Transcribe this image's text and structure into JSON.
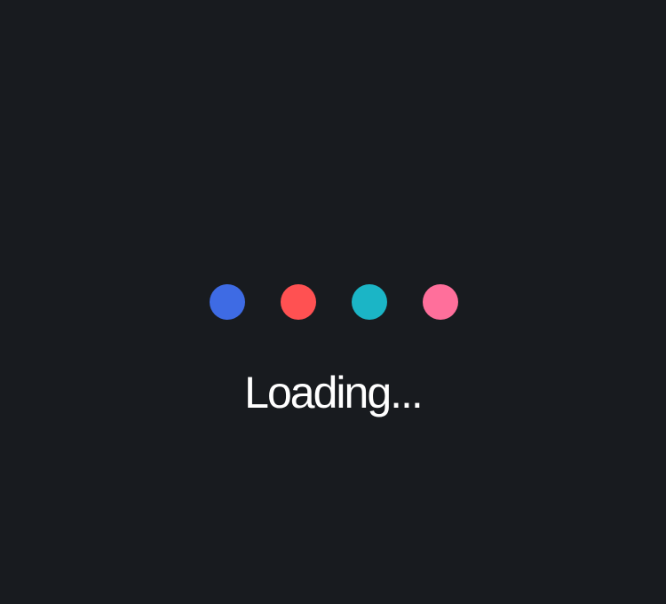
{
  "loader": {
    "text": "Loading...",
    "dots": [
      {
        "color": "#3e6be4",
        "label": ""
      },
      {
        "color": "#ff5152",
        "label": ""
      },
      {
        "color": "#1bb5c6",
        "label": ""
      },
      {
        "color": "#ff6f9b",
        "label": ""
      }
    ]
  },
  "colors": {
    "background": "#181b1f",
    "text": "#ffffff"
  }
}
